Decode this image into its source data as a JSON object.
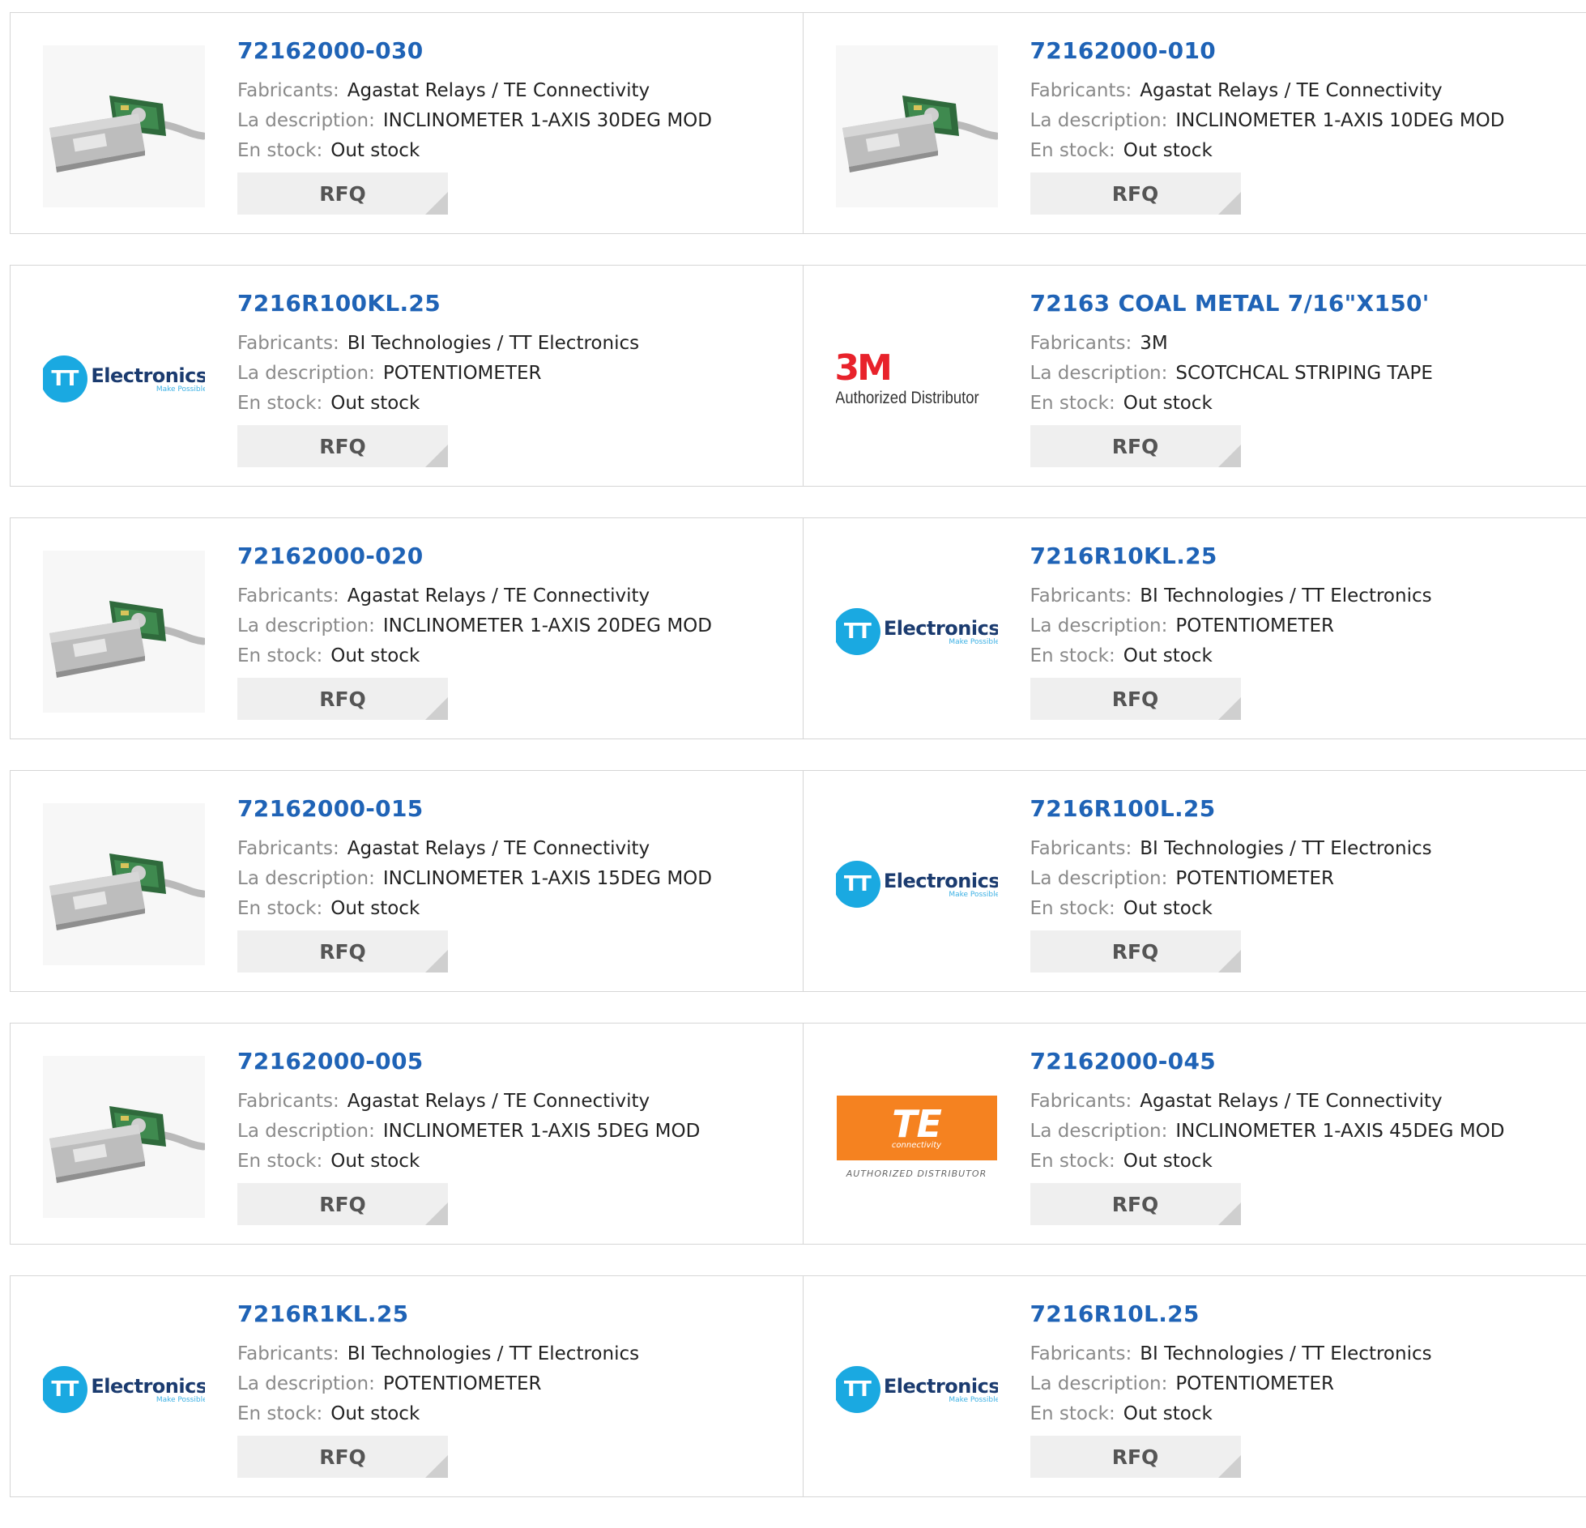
{
  "labels": {
    "manufacturer": "Fabricants:",
    "description": "La description:",
    "stock": "En stock:",
    "rfq": "RFQ"
  },
  "products": [
    {
      "part": "72162000-030",
      "manufacturer": "Agastat Relays / TE Connectivity",
      "description": "INCLINOMETER 1-AXIS 30DEG MOD",
      "stock": "Out stock",
      "image": "inclinometer-photo"
    },
    {
      "part": "72162000-010",
      "manufacturer": "Agastat Relays / TE Connectivity",
      "description": "INCLINOMETER 1-AXIS 10DEG MOD",
      "stock": "Out stock",
      "image": "inclinometer-photo"
    },
    {
      "part": "7216R100KL.25",
      "manufacturer": "BI Technologies / TT Electronics",
      "description": "POTENTIOMETER",
      "stock": "Out stock",
      "image": "tt-electronics-logo"
    },
    {
      "part": "72163 COAL METAL 7/16\"X150'",
      "manufacturer": "3M",
      "description": "SCOTCHCAL STRIPING TAPE",
      "stock": "Out stock",
      "image": "3m-logo"
    },
    {
      "part": "72162000-020",
      "manufacturer": "Agastat Relays / TE Connectivity",
      "description": "INCLINOMETER 1-AXIS 20DEG MOD",
      "stock": "Out stock",
      "image": "inclinometer-photo"
    },
    {
      "part": "7216R10KL.25",
      "manufacturer": "BI Technologies / TT Electronics",
      "description": "POTENTIOMETER",
      "stock": "Out stock",
      "image": "tt-electronics-logo"
    },
    {
      "part": "72162000-015",
      "manufacturer": "Agastat Relays / TE Connectivity",
      "description": "INCLINOMETER 1-AXIS 15DEG MOD",
      "stock": "Out stock",
      "image": "inclinometer-photo"
    },
    {
      "part": "7216R100L.25",
      "manufacturer": "BI Technologies / TT Electronics",
      "description": "POTENTIOMETER",
      "stock": "Out stock",
      "image": "tt-electronics-logo"
    },
    {
      "part": "72162000-005",
      "manufacturer": "Agastat Relays / TE Connectivity",
      "description": "INCLINOMETER 1-AXIS 5DEG MOD",
      "stock": "Out stock",
      "image": "inclinometer-photo"
    },
    {
      "part": "72162000-045",
      "manufacturer": "Agastat Relays / TE Connectivity",
      "description": "INCLINOMETER 1-AXIS 45DEG MOD",
      "stock": "Out stock",
      "image": "te-connectivity-logo"
    },
    {
      "part": "7216R1KL.25",
      "manufacturer": "BI Technologies / TT Electronics",
      "description": "POTENTIOMETER",
      "stock": "Out stock",
      "image": "tt-electronics-logo"
    },
    {
      "part": "7216R10L.25",
      "manufacturer": "BI Technologies / TT Electronics",
      "description": "POTENTIOMETER",
      "stock": "Out stock",
      "image": "tt-electronics-logo"
    }
  ],
  "logos": {
    "tt": {
      "mark": "TT",
      "word": "Electronics",
      "tagline": "Make Possible"
    },
    "m3": {
      "mark": "3M",
      "subtitle": "Authorized Distributor"
    },
    "te": {
      "mark": "TE",
      "subtitle": "connectivity",
      "distributor": "AUTHORIZED DISTRIBUTOR"
    }
  },
  "colors": {
    "part_link": "#1f63b6",
    "label_gray": "#8a8a8a",
    "rfq_bg": "#efefef",
    "tt_blue": "#1aa9e1",
    "m3_red": "#e8222b",
    "te_orange": "#f58220"
  }
}
